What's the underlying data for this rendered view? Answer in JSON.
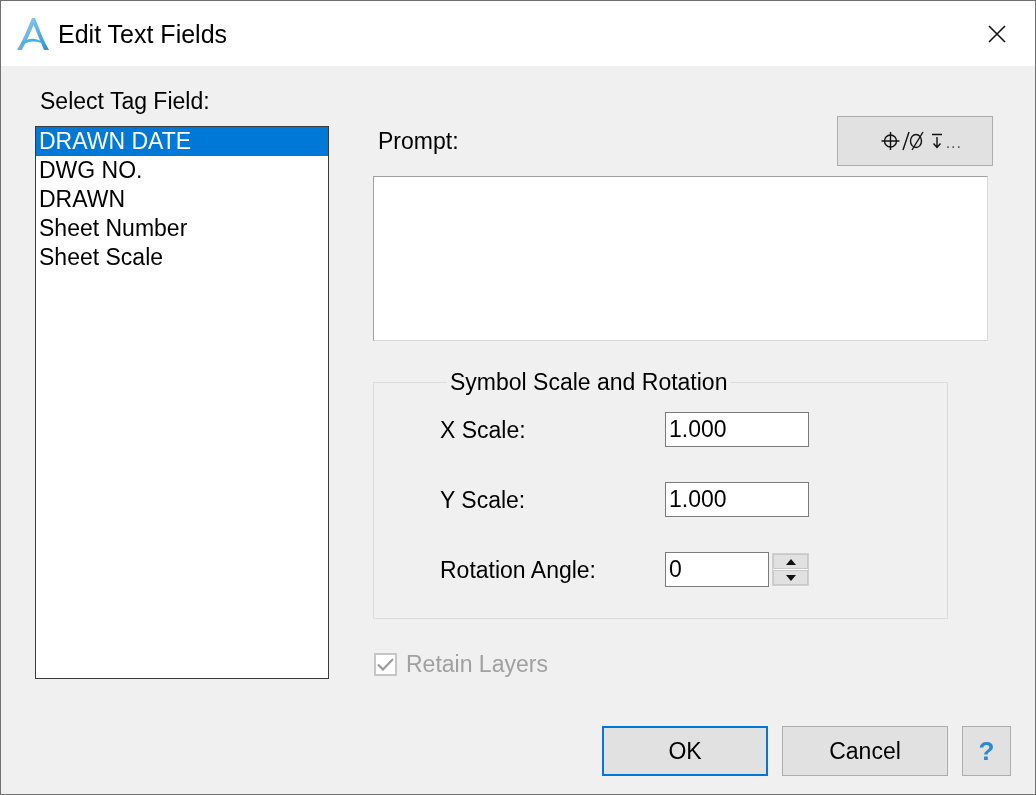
{
  "window": {
    "title": "Edit Text Fields"
  },
  "tag_field": {
    "label": "Select Tag Field:",
    "items": [
      {
        "label": "DRAWN DATE",
        "selected": true
      },
      {
        "label": "DWG NO.",
        "selected": false
      },
      {
        "label": "DRAWN",
        "selected": false
      },
      {
        "label": "Sheet Number",
        "selected": false
      },
      {
        "label": "Sheet Scale",
        "selected": false
      }
    ]
  },
  "prompt": {
    "label": "Prompt:"
  },
  "symbol_button": {
    "label": "..."
  },
  "scale_rotation": {
    "title": "Symbol Scale and Rotation",
    "fields": [
      {
        "kind": "text",
        "label": "X Scale:",
        "value": "1.000"
      },
      {
        "kind": "text",
        "label": "Y Scale:",
        "value": "1.000"
      },
      {
        "kind": "spinner",
        "label": "Rotation Angle:",
        "value": "0"
      }
    ]
  },
  "retain_layers": {
    "label": "Retain Layers",
    "checked": true,
    "disabled": true
  },
  "buttons": [
    {
      "kind": "ok",
      "label": "OK"
    },
    {
      "kind": "cancel",
      "label": "Cancel"
    },
    {
      "kind": "help",
      "label": "?"
    }
  ]
}
